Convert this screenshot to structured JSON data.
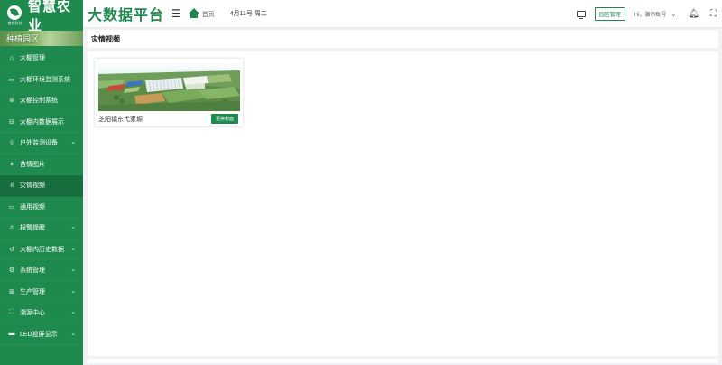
{
  "brand": {
    "logo_sub": "睿农科技",
    "name": "智慧农业"
  },
  "header": {
    "platform_title": "大数据平台",
    "home_label": "首页",
    "date": "4月11号 周二",
    "park_mgmt_label": "园区管理",
    "user_label": "Hi，演示账号"
  },
  "sidebar": {
    "park_name": "种植园区",
    "items": [
      {
        "label": "大棚管理",
        "icon": "home-icon",
        "expandable": false
      },
      {
        "label": "大棚环境监测系统",
        "icon": "monitor-icon",
        "expandable": false
      },
      {
        "label": "大棚控制系统",
        "icon": "control-icon",
        "expandable": false
      },
      {
        "label": "大棚内数据展示",
        "icon": "data-display-icon",
        "expandable": false
      },
      {
        "label": "户外监测设备",
        "icon": "outdoor-device-icon",
        "expandable": true
      },
      {
        "label": "苗情图片",
        "icon": "seedling-icon",
        "expandable": false
      },
      {
        "label": "灾情视频",
        "icon": "chart-icon",
        "expandable": false,
        "active": true
      },
      {
        "label": "通用视频",
        "icon": "video-icon",
        "expandable": false
      },
      {
        "label": "报警提醒",
        "icon": "alert-icon",
        "expandable": true
      },
      {
        "label": "大棚内历史数据",
        "icon": "history-icon",
        "expandable": true
      },
      {
        "label": "系统管理",
        "icon": "settings-icon",
        "expandable": true
      },
      {
        "label": "生产管理",
        "icon": "production-icon",
        "expandable": true
      },
      {
        "label": "溯源中心",
        "icon": "trace-icon",
        "expandable": true
      },
      {
        "label": "LED投屏显示",
        "icon": "led-icon",
        "expandable": true
      }
    ]
  },
  "page": {
    "title": "灾情视频",
    "cards": [
      {
        "name": "芝阳镇东弋家塬",
        "button_label": "更换封面"
      }
    ]
  },
  "colors": {
    "primary": "#1e8a4d",
    "sidebar_active": "#176e3d",
    "background": "#f0f2f5"
  }
}
